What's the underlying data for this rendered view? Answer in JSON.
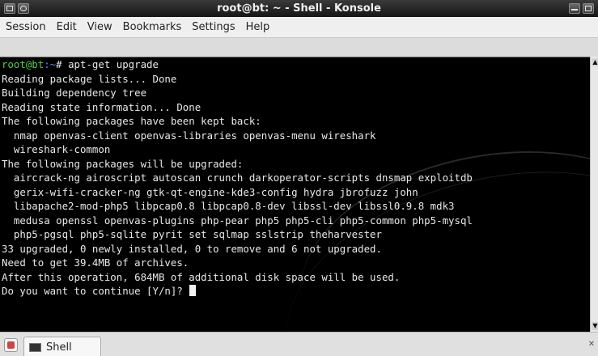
{
  "window": {
    "title": "root@bt: ~ - Shell - Konsole"
  },
  "menu": {
    "items": [
      "Session",
      "Edit",
      "View",
      "Bookmarks",
      "Settings",
      "Help"
    ]
  },
  "terminal": {
    "prompt_user": "root@bt",
    "prompt_path": ":~",
    "prompt_symbol": "#",
    "command": " apt-get upgrade",
    "lines": [
      "Reading package lists... Done",
      "Building dependency tree",
      "Reading state information... Done",
      "The following packages have been kept back:",
      "  nmap openvas-client openvas-libraries openvas-menu wireshark",
      "  wireshark-common",
      "The following packages will be upgraded:",
      "  aircrack-ng airoscript autoscan crunch darkoperator-scripts dnsmap exploitdb",
      "  gerix-wifi-cracker-ng gtk-qt-engine-kde3-config hydra jbrofuzz john",
      "  libapache2-mod-php5 libpcap0.8 libpcap0.8-dev libssl-dev libssl0.9.8 mdk3",
      "  medusa openssl openvas-plugins php-pear php5 php5-cli php5-common php5-mysql",
      "  php5-pgsql php5-sqlite pyrit set sqlmap sslstrip theharvester",
      "33 upgraded, 0 newly installed, 0 to remove and 6 not upgraded.",
      "Need to get 39.4MB of archives.",
      "After this operation, 684MB of additional disk space will be used."
    ],
    "final_prompt": "Do you want to continue [Y/n]? "
  },
  "tabs": {
    "items": [
      {
        "label": "Shell",
        "icon": "terminal-icon"
      }
    ]
  }
}
